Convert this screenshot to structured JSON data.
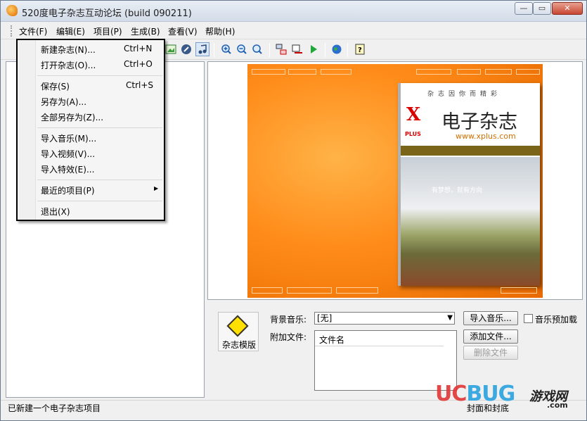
{
  "window": {
    "title": "520度电子杂志互动论坛 (build 090211)",
    "min": "—",
    "max": "▭",
    "close": "✕"
  },
  "menu": [
    "文件(F)",
    "编辑(E)",
    "项目(P)",
    "生成(B)",
    "查看(V)",
    "帮助(H)"
  ],
  "file_menu": {
    "items": [
      {
        "label": "新建杂志(N)...",
        "shortcut": "Ctrl+N"
      },
      {
        "label": "打开杂志(O)...",
        "shortcut": "Ctrl+O"
      },
      {
        "label": "保存(S)",
        "shortcut": "Ctrl+S"
      },
      {
        "label": "另存为(A)...",
        "shortcut": ""
      },
      {
        "label": "全部另存为(Z)...",
        "shortcut": ""
      },
      {
        "label": "导入音乐(M)...",
        "shortcut": ""
      },
      {
        "label": "导入视频(V)...",
        "shortcut": ""
      },
      {
        "label": "导入特效(E)...",
        "shortcut": ""
      },
      {
        "label": "最近的项目(P)",
        "shortcut": ""
      },
      {
        "label": "退出(X)",
        "shortcut": ""
      }
    ]
  },
  "toolbar_icons": [
    "image-icon",
    "wrench-icon",
    "music-icon",
    "zoom-in-icon",
    "zoom-out-icon",
    "zoom-fit-icon",
    "network-icon",
    "publish-icon",
    "play-icon",
    "globe-icon",
    "help-icon"
  ],
  "preview": {
    "cover_slogan": "杂志因你而精彩",
    "cover_logo": "X",
    "cover_logo_sub": "PLUS",
    "cover_title": "电子杂志",
    "cover_url": "www.xplus.com",
    "cover_photo_text": "有梦想，就有方向"
  },
  "bottom": {
    "template_label": "杂志模版",
    "bg_music_label": "背景音乐:",
    "bg_music_value": "[无]",
    "attach_label": "附加文件:",
    "file_column": "文件名",
    "import_music_btn": "导入音乐...",
    "preload_label": "音乐预加载",
    "add_file_btn": "添加文件...",
    "delete_file_btn": "删除文件"
  },
  "status": {
    "left": "已新建一个电子杂志项目",
    "mid": "封面和封底"
  },
  "watermark": {
    "uc": "UC",
    "bug": "BUG",
    "cn": "游戏网",
    "com": ".com"
  }
}
